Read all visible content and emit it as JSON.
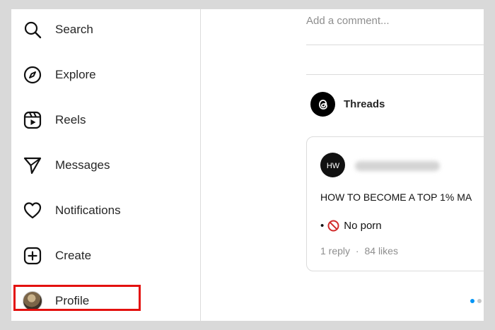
{
  "sidebar": {
    "items": [
      {
        "label": "Search",
        "icon": "search-icon"
      },
      {
        "label": "Explore",
        "icon": "compass-icon"
      },
      {
        "label": "Reels",
        "icon": "reels-icon"
      },
      {
        "label": "Messages",
        "icon": "send-icon"
      },
      {
        "label": "Notifications",
        "icon": "heart-icon"
      },
      {
        "label": "Create",
        "icon": "plus-square-icon"
      },
      {
        "label": "Profile",
        "icon": "avatar"
      }
    ]
  },
  "comment": {
    "placeholder": "Add a comment..."
  },
  "threads": {
    "label": "Threads",
    "icon": "threads-icon"
  },
  "post": {
    "avatar_text": "HW",
    "title": "HOW TO BECOME A TOP 1% MA",
    "bullet_prefix": "•",
    "bullet_text": "No porn",
    "bullet_icon": "prohibited-icon",
    "replies": "1 reply",
    "separator": "·",
    "likes": "84 likes"
  },
  "colors": {
    "highlight": "#e3110f",
    "active_dot": "#0095f6"
  }
}
